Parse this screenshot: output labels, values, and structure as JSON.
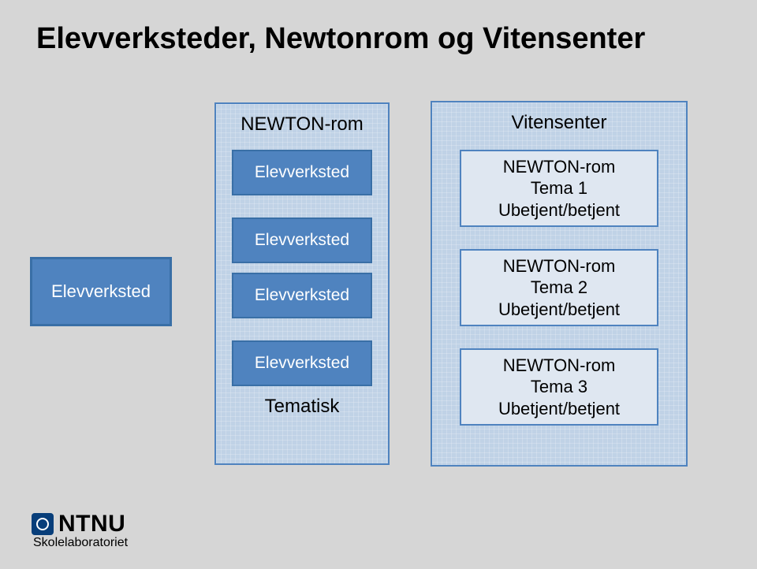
{
  "title": "Elevverksteder, Newtonrom og Vitensenter",
  "left": {
    "label": "Elevverksted"
  },
  "middle": {
    "header": "NEWTON-rom",
    "items": [
      "Elevverksted",
      "Elevverksted",
      "Elevverksted",
      "Elevverksted"
    ],
    "footer": "Tematisk"
  },
  "right": {
    "header": "Vitensenter",
    "boxes": [
      {
        "line1": "NEWTON-rom",
        "line2": "Tema 1",
        "line3": "Ubetjent/betjent"
      },
      {
        "line1": "NEWTON-rom",
        "line2": "Tema 2",
        "line3": "Ubetjent/betjent"
      },
      {
        "line1": "NEWTON-rom",
        "line2": "Tema 3",
        "line3": "Ubetjent/betjent"
      }
    ]
  },
  "footer": {
    "logo": "NTNU",
    "sub": "Skolelaboratoriet"
  }
}
